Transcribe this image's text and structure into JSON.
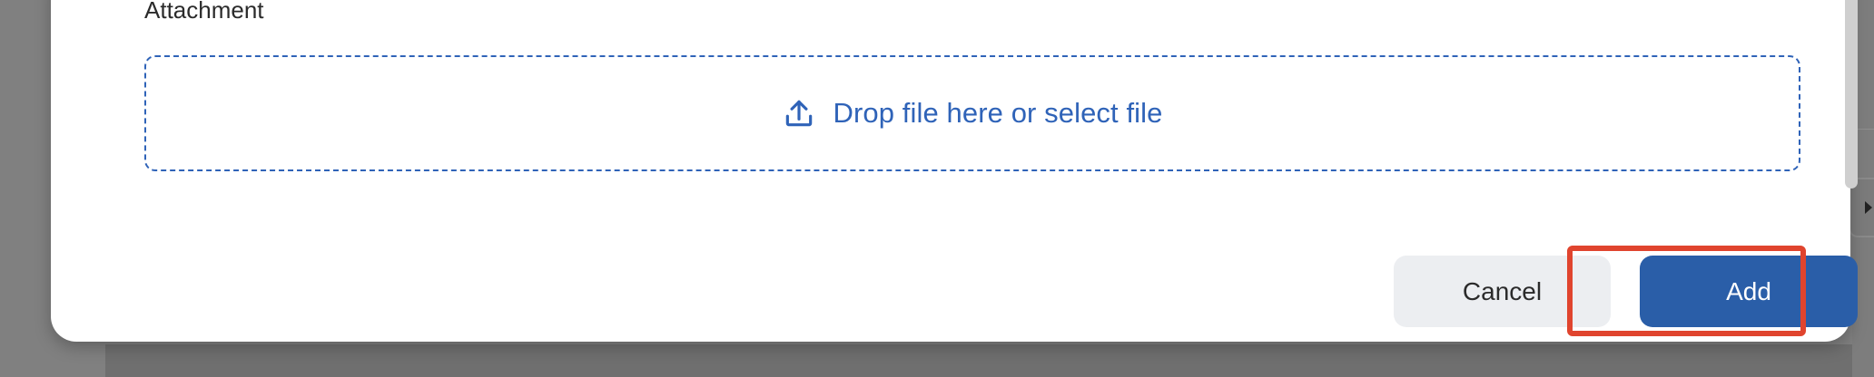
{
  "form": {
    "attachment_label": "Attachment",
    "dropzone_text": "Drop file here or select file"
  },
  "actions": {
    "cancel_label": "Cancel",
    "add_label": "Add"
  },
  "icons": {
    "upload": "upload-icon"
  },
  "colors": {
    "primary": "#2a5ea8",
    "link": "#2f63b8",
    "highlight": "#e0442e",
    "cancel_bg": "#eceef1"
  }
}
